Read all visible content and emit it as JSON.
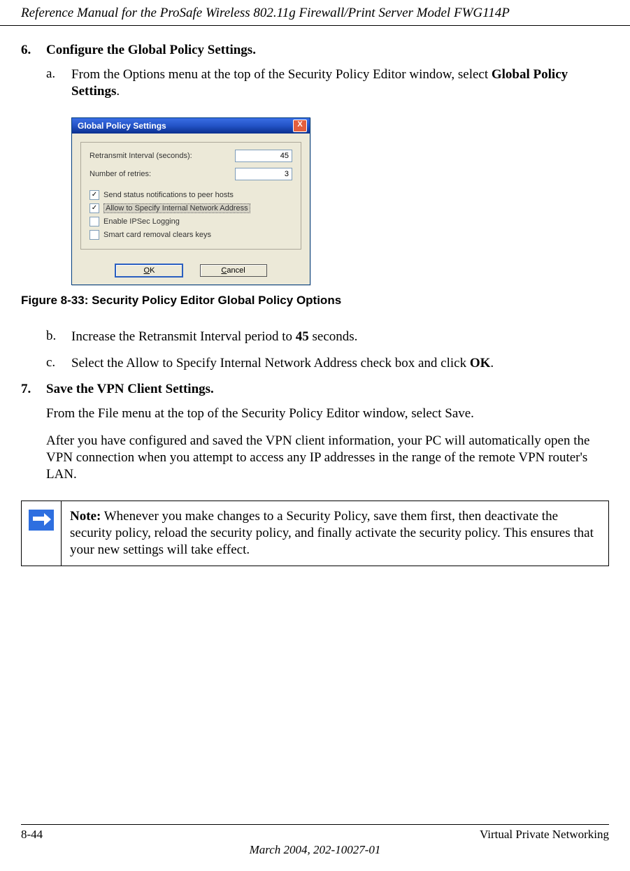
{
  "header": {
    "title": "Reference Manual for the ProSafe Wireless 802.11g  Firewall/Print Server Model FWG114P"
  },
  "step6": {
    "num": "6.",
    "title": "Configure the Global Policy Settings.",
    "a_letter": "a.",
    "a_text_pre": "From the Options menu at the top of the Security Policy Editor window, select ",
    "a_bold": "Global Policy Settings",
    "a_text_post": ".",
    "b_letter": "b.",
    "b_text_pre": "Increase the Retransmit Interval period to ",
    "b_bold": "45",
    "b_text_post": " seconds.",
    "c_letter": "c.",
    "c_text_pre": "Select the Allow to Specify Internal Network Address check box and click ",
    "c_bold": "OK",
    "c_text_post": "."
  },
  "dialog": {
    "title": "Global Policy Settings",
    "close": "X",
    "retransmit_label": "Retransmit Interval (seconds):",
    "retransmit_value": "45",
    "retries_label": "Number of retries:",
    "retries_value": "3",
    "cb1": "Send status notifications to peer hosts",
    "cb2": "Allow to Specify Internal Network Address",
    "cb3": "Enable IPSec Logging",
    "cb4": "Smart card removal clears keys",
    "ok_u": "O",
    "ok_rest": "K",
    "cancel_u": "C",
    "cancel_rest": "ancel"
  },
  "figure": {
    "caption": "Figure 8-33:  Security Policy Editor Global Policy Options"
  },
  "step7": {
    "num": "7.",
    "title": "Save the VPN Client Settings.",
    "p1": "From the File menu at the top of the Security Policy Editor window, select Save.",
    "p2": "After you have configured and saved the VPN client information, your PC will automatically open the VPN connection when you attempt to access any IP addresses in the range of the remote VPN router's LAN."
  },
  "note": {
    "label": "Note:",
    "text": " Whenever you make changes to a Security Policy, save them first, then deactivate the security policy, reload the security policy, and finally activate the security policy. This ensures that your new settings will take effect."
  },
  "footer": {
    "page": "8-44",
    "section": "Virtual Private Networking",
    "date": "March 2004, 202-10027-01"
  }
}
